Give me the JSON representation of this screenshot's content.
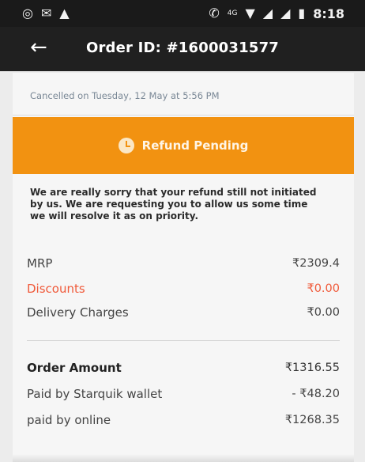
{
  "statusbar": {
    "time": "8:18",
    "network_label": "4G",
    "icons": [
      "whatsapp-icon",
      "message-icon",
      "android-icon",
      "vibrate-icon",
      "wifi-icon",
      "signal-icon",
      "signal-icon",
      "battery-icon"
    ]
  },
  "appbar": {
    "title": "Order ID: #1600031577",
    "back_icon": "←"
  },
  "order": {
    "cancelled_text": "Cancelled on Tuesday, 12 May at 5:56 PM",
    "refund_status": "Refund Pending",
    "message": "We are really sorry that your refund still not initiated by us. We are requesting you to allow us some time we will resolve it as on priority."
  },
  "breakdown": {
    "mrp_label": "MRP",
    "mrp_value": "₹2309.4",
    "discount_label": "Discounts",
    "discount_value": "₹0.00",
    "delivery_label": "Delivery Charges",
    "delivery_value": "₹0.00"
  },
  "totals": {
    "order_amount_label": "Order Amount",
    "order_amount_value": "₹1316.55",
    "wallet_label": "Paid by Starquik wallet",
    "wallet_value": "- ₹48.20",
    "online_label": "paid by online",
    "online_value": "₹1268.35"
  },
  "colors": {
    "accent": "#f29211",
    "discount": "#f05a3a",
    "appbar": "#202020"
  }
}
